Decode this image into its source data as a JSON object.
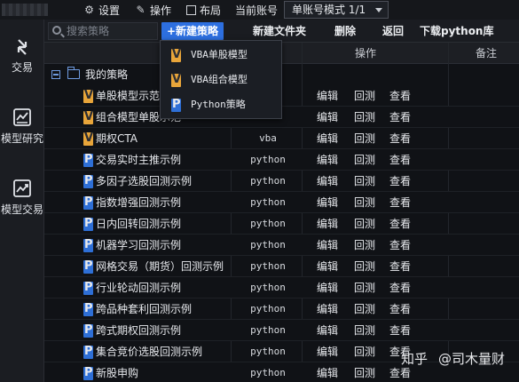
{
  "topbar": {
    "settings": "设置",
    "operations": "操作",
    "layout": "布局",
    "current_account": "当前账号",
    "account_mode": "单账号模式 1/1"
  },
  "leftnav": {
    "items": [
      {
        "label": "交易",
        "icon": "swap-arrows-icon"
      },
      {
        "label": "模型研究",
        "icon": "chart-window-icon"
      },
      {
        "label": "模型交易",
        "icon": "trend-chart-icon"
      }
    ]
  },
  "toolbar": {
    "search_placeholder": "搜索策略",
    "new_strategy": "+新建策略",
    "new_folder": "新建文件夹",
    "delete": "删除",
    "back": "返回",
    "download_python": "下载python库"
  },
  "table": {
    "headers": {
      "operation": "操作",
      "remark": "备注"
    },
    "root": "我的策略",
    "actions": {
      "edit": "编辑",
      "backtest": "回测",
      "view": "查看"
    },
    "rows": [
      {
        "name": "单股模型示范",
        "icon": "vba-file-icon",
        "type": ""
      },
      {
        "name": "组合模型单股示范",
        "icon": "vba-file-icon",
        "type": ""
      },
      {
        "name": "期权CTA",
        "icon": "vba-file-icon",
        "type": "vba"
      },
      {
        "name": "交易实时主推示例",
        "icon": "python-file-icon",
        "type": "python"
      },
      {
        "name": "多因子选股回测示例",
        "icon": "python-file-icon",
        "type": "python"
      },
      {
        "name": "指数增强回测示例",
        "icon": "python-file-icon",
        "type": "python"
      },
      {
        "name": "日内回转回测示例",
        "icon": "python-file-icon",
        "type": "python"
      },
      {
        "name": "机器学习回测示例",
        "icon": "python-file-icon",
        "type": "python"
      },
      {
        "name": "网格交易（期货）回测示例",
        "icon": "python-file-icon",
        "type": "python"
      },
      {
        "name": "行业轮动回测示例",
        "icon": "python-file-icon",
        "type": "python"
      },
      {
        "name": "跨品种套利回测示例",
        "icon": "python-file-icon",
        "type": "python"
      },
      {
        "name": "跨式期权回测示例",
        "icon": "python-file-icon",
        "type": "python"
      },
      {
        "name": "集合竞价选股回测示例",
        "icon": "python-file-icon",
        "type": "python"
      },
      {
        "name": "新股申购",
        "icon": "python-file-icon",
        "type": "python"
      }
    ]
  },
  "dropdown": {
    "items": [
      {
        "label": "VBA单股模型",
        "icon": "vba-file-icon"
      },
      {
        "label": "VBA组合模型",
        "icon": "vba-file-icon"
      },
      {
        "label": "Python策略",
        "icon": "python-file-icon"
      }
    ]
  },
  "watermark": {
    "brand": "知乎",
    "author": "@司木量财"
  },
  "colors": {
    "accent": "#2d6fe0",
    "vba": "#e8a53a",
    "python": "#2e6fd6",
    "background": "#101216"
  }
}
